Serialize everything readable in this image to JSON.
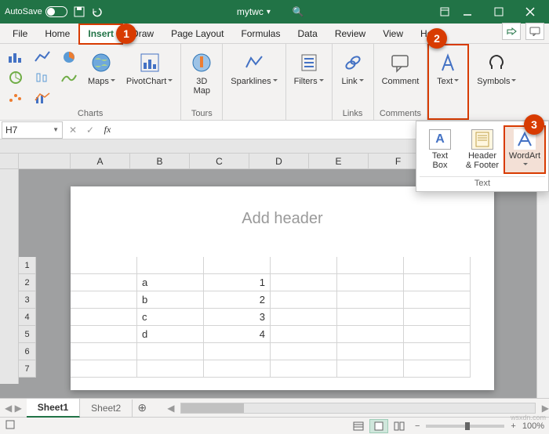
{
  "title": {
    "autosave_label": "AutoSave",
    "doc_name": "mytwc",
    "search_icon": "🔍"
  },
  "tabs": {
    "file": "File",
    "home": "Home",
    "insert": "Insert",
    "draw": "Draw",
    "page_layout": "Page Layout",
    "formulas": "Formulas",
    "data": "Data",
    "review": "Review",
    "view": "View",
    "help": "Help"
  },
  "ribbon": {
    "charts_label": "Charts",
    "maps": "Maps",
    "pivotchart": "PivotChart",
    "tours_label": "Tours",
    "map3d": "3D\nMap",
    "sparklines": "Sparklines",
    "filters": "Filters",
    "link": "Link",
    "links_label": "Links",
    "comment": "Comment",
    "comments_label": "Comments",
    "text": "Text",
    "symbols": "Symbols"
  },
  "flyout": {
    "textbox": "Text\nBox",
    "headerfooter": "Header\n& Footer",
    "wordart": "WordArt",
    "group_label": "Text"
  },
  "namebox": "H7",
  "columns": [
    "A",
    "B",
    "C",
    "D",
    "E",
    "F"
  ],
  "rows": [
    "1",
    "2",
    "3",
    "4",
    "5",
    "6",
    "7"
  ],
  "header_placeholder": "Add header",
  "cells": {
    "B2": "a",
    "C2": "1",
    "B3": "b",
    "C3": "2",
    "B4": "c",
    "C4": "3",
    "B5": "d",
    "C5": "4"
  },
  "sheets": {
    "s1": "Sheet1",
    "s2": "Sheet2"
  },
  "zoom": "100%",
  "callouts": {
    "c1": "1",
    "c2": "2",
    "c3": "3"
  },
  "watermark": "wsxdn.com"
}
